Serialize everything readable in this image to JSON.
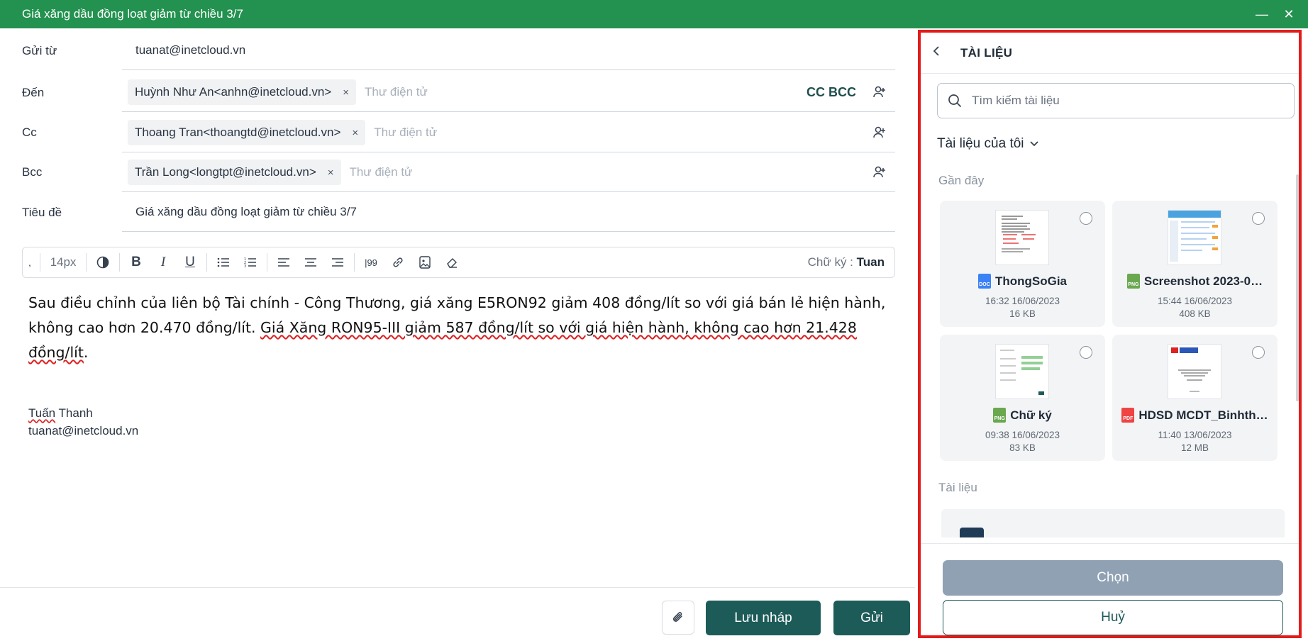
{
  "window": {
    "title": "Giá xăng dầu đồng loạt giảm từ chiều 3/7",
    "minimize": "—",
    "close": "✕"
  },
  "compose": {
    "from_label": "Gửi từ",
    "from_value": "tuanat@inetcloud.vn",
    "to_label": "Đến",
    "to_chips": [
      "Huỳnh Như An<anhn@inetcloud.vn>"
    ],
    "cc_label": "Cc",
    "cc_chips": [
      "Thoang Tran<thoangtd@inetcloud.vn>"
    ],
    "bcc_label": "Bcc",
    "bcc_chips": [
      "Trần Long<longtpt@inetcloud.vn>"
    ],
    "email_placeholder": "Thư điện tử",
    "cc_bcc_toggle": "CC BCC",
    "subject_label": "Tiêu đề",
    "subject_value": "Giá xăng dầu đồng loạt giảm từ chiều 3/7",
    "chip_remove": "×"
  },
  "toolbar": {
    "font_size": "14px",
    "signature_label": "Chữ ký :",
    "signature_value": "Tuan"
  },
  "body": {
    "p1": "Sau điều chỉnh của liên bộ Tài chính - Công Thương, giá xăng E5RON92 giảm 408 đồng/lít so với giá bán lẻ hiện hành, không cao hơn 20.470 đồng/lít. ",
    "p1_marked": "Giá Xăng RON95-III giảm 587 đồng/lít so với giá hiện hành, không cao hơn 21.428 đồng/lít",
    "p1_end": ".",
    "sig_name_a": "Tuấn",
    "sig_name_b": " Thanh",
    "sig_email": "tuanat@inetcloud.vn"
  },
  "footer": {
    "save_draft": "Lưu nháp",
    "send": "Gửi"
  },
  "panel": {
    "title": "TÀI LIỆU",
    "search_placeholder": "Tìm kiếm tài liệu",
    "my_docs": "Tài liệu của tôi",
    "recent_label": "Gần đây",
    "docs_label": "Tài liệu",
    "recent": [
      {
        "name": "ThongSoGia",
        "time": "16:32 16/06/2023",
        "size": "16 KB",
        "type": "DOC",
        "color": "#3b82f6"
      },
      {
        "name": "Screenshot 2023-0…",
        "time": "15:44 16/06/2023",
        "size": "408 KB",
        "type": "PNG",
        "color": "#6aa84f"
      },
      {
        "name": "Chữ ký",
        "time": "09:38 16/06/2023",
        "size": "83 KB",
        "type": "PNG",
        "color": "#6aa84f"
      },
      {
        "name": "HDSD MCDT_Binhth…",
        "time": "11:40 13/06/2023",
        "size": "12 MB",
        "type": "PDF",
        "color": "#ef4444"
      }
    ],
    "choose_button": "Chọn",
    "cancel_button": "Huỷ"
  }
}
